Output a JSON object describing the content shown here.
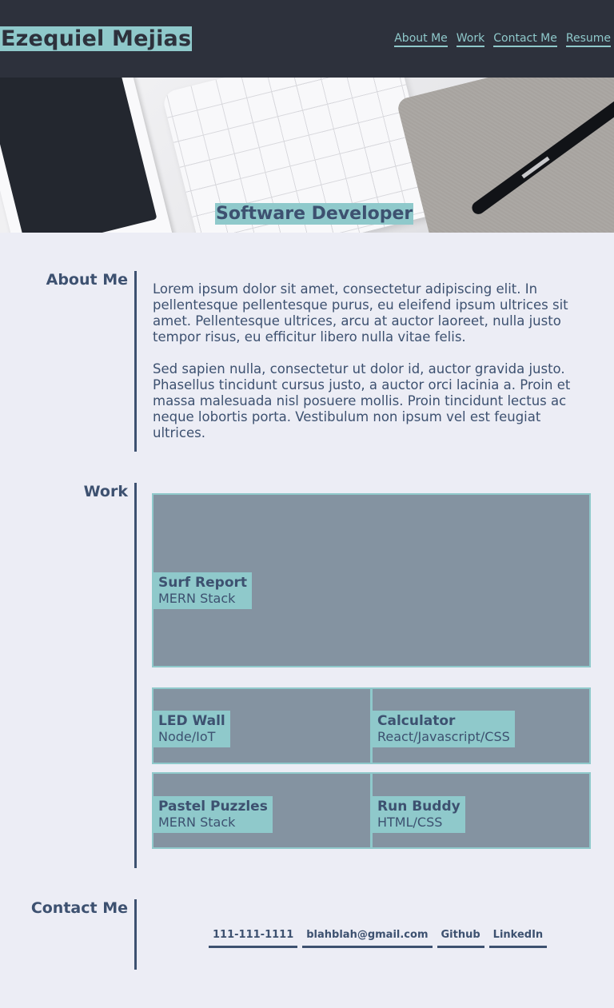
{
  "header": {
    "name": "Ezequiel Mejias",
    "nav": [
      {
        "label": "About Me",
        "name": "nav-about-me"
      },
      {
        "label": "Work",
        "name": "nav-work"
      },
      {
        "label": "Contact Me",
        "name": "nav-contact-me"
      },
      {
        "label": "Resume",
        "name": "nav-resume"
      }
    ]
  },
  "hero": {
    "subtitle": "Software Developer"
  },
  "about": {
    "heading": "About Me",
    "paragraphs": [
      "Lorem ipsum dolor sit amet, consectetur adipiscing elit. In pellentesque pellentesque purus, eu eleifend ipsum ultrices sit amet. Pellentesque ultrices, arcu at auctor laoreet, nulla justo tempor risus, eu efficitur libero nulla vitae felis.",
      "Sed sapien nulla, consectetur ut dolor id, auctor gravida justo. Phasellus tincidunt cursus justo, a auctor orci lacinia a. Proin et massa malesuada nisl posuere mollis. Proin tincidunt lectus ac neque lobortis porta. Vestibulum non ipsum vel est feugiat ultrices."
    ]
  },
  "work": {
    "heading": "Work",
    "projects": [
      {
        "name": "Surf Report",
        "tech": "MERN Stack"
      },
      {
        "name": "LED Wall",
        "tech": "Node/IoT"
      },
      {
        "name": "Calculator",
        "tech": "React/Javascript/CSS"
      },
      {
        "name": "Pastel Puzzles",
        "tech": "MERN Stack"
      },
      {
        "name": "Run Buddy",
        "tech": "HTML/CSS"
      }
    ]
  },
  "contact": {
    "heading": "Contact Me",
    "links": [
      {
        "label": "111-111-1111"
      },
      {
        "label": "blahblah@gmail.com"
      },
      {
        "label": "Github"
      },
      {
        "label": "LinkedIn"
      }
    ]
  },
  "colors": {
    "header_bg": "#2d313c",
    "accent": "#8fc9cb",
    "text": "#3d5170",
    "card_bg": "#8493a1",
    "page_bg": "#ecedf5"
  }
}
